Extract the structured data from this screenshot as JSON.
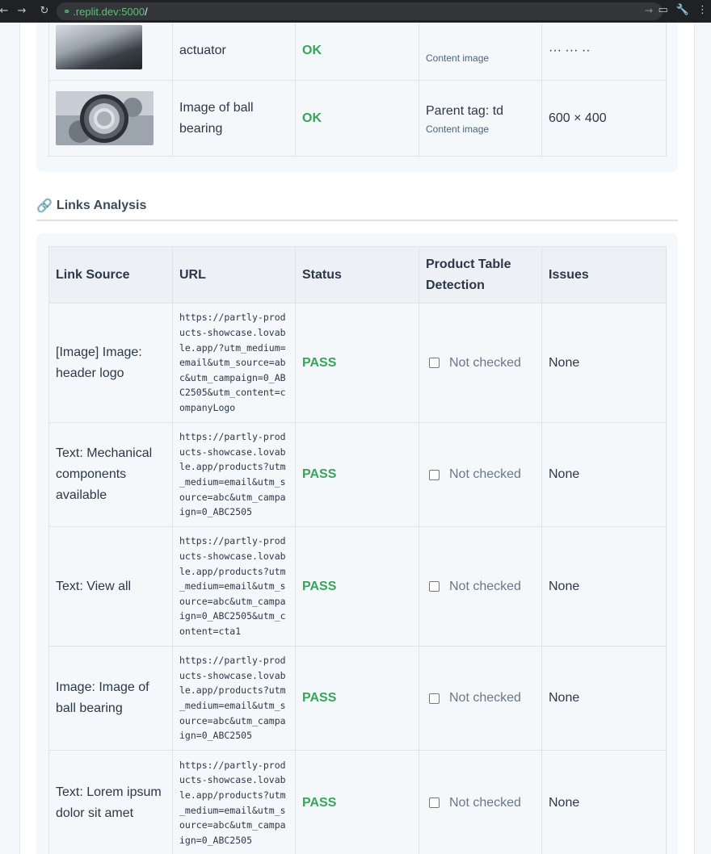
{
  "browser": {
    "url_host": ".replit.dev:5000",
    "url_path": "/"
  },
  "images_table": {
    "rows": [
      {
        "alt": "actuator",
        "status": "OK",
        "parent_tag": "",
        "tag_note": "Content image",
        "dimensions": "",
        "thumb": "actuator"
      },
      {
        "alt": "Image of ball bearing",
        "status": "OK",
        "parent_tag": "Parent tag: td",
        "tag_note": "Content image",
        "dimensions": "600 × 400",
        "thumb": "ball-bearing"
      }
    ]
  },
  "links_section": {
    "icon": "link-icon",
    "title": "Links Analysis",
    "headers": [
      "Link Source",
      "URL",
      "Status",
      "Product Table Detection",
      "Issues"
    ],
    "rows": [
      {
        "source": "[Image] Image: header logo",
        "url": "https://partly-products-showcase.lovable.app/?utm_medium=email&utm_source=abc&utm_campaign=0_ABC2505&utm_content=companyLogo",
        "status": "PASS",
        "detection": "Not checked",
        "issues": "None"
      },
      {
        "source": "Text: Mechanical components available",
        "url": "https://partly-products-showcase.lovable.app/products?utm_medium=email&utm_source=abc&utm_campaign=0_ABC2505",
        "status": "PASS",
        "detection": "Not checked",
        "issues": "None"
      },
      {
        "source": "Text: View all",
        "url": "https://partly-products-showcase.lovable.app/products?utm_medium=email&utm_source=abc&utm_campaign=0_ABC2505&utm_content=cta1",
        "status": "PASS",
        "detection": "Not checked",
        "issues": "None"
      },
      {
        "source": "Image: Image of ball bearing",
        "url": "https://partly-products-showcase.lovable.app/products?utm_medium=email&utm_source=abc&utm_campaign=0_ABC2505",
        "status": "PASS",
        "detection": "Not checked",
        "issues": "None"
      },
      {
        "source": "Text: Lorem ipsum dolor sit amet",
        "url": "https://partly-products-showcase.lovable.app/products?utm_medium=email&utm_source=abc&utm_campaign=0_ABC2505",
        "status": "PASS",
        "detection": "Not checked",
        "issues": "None"
      }
    ]
  },
  "colors": {
    "pass": "#37a559",
    "panel_bg": "#f5f8fb",
    "header_bg": "#edf1f6"
  }
}
